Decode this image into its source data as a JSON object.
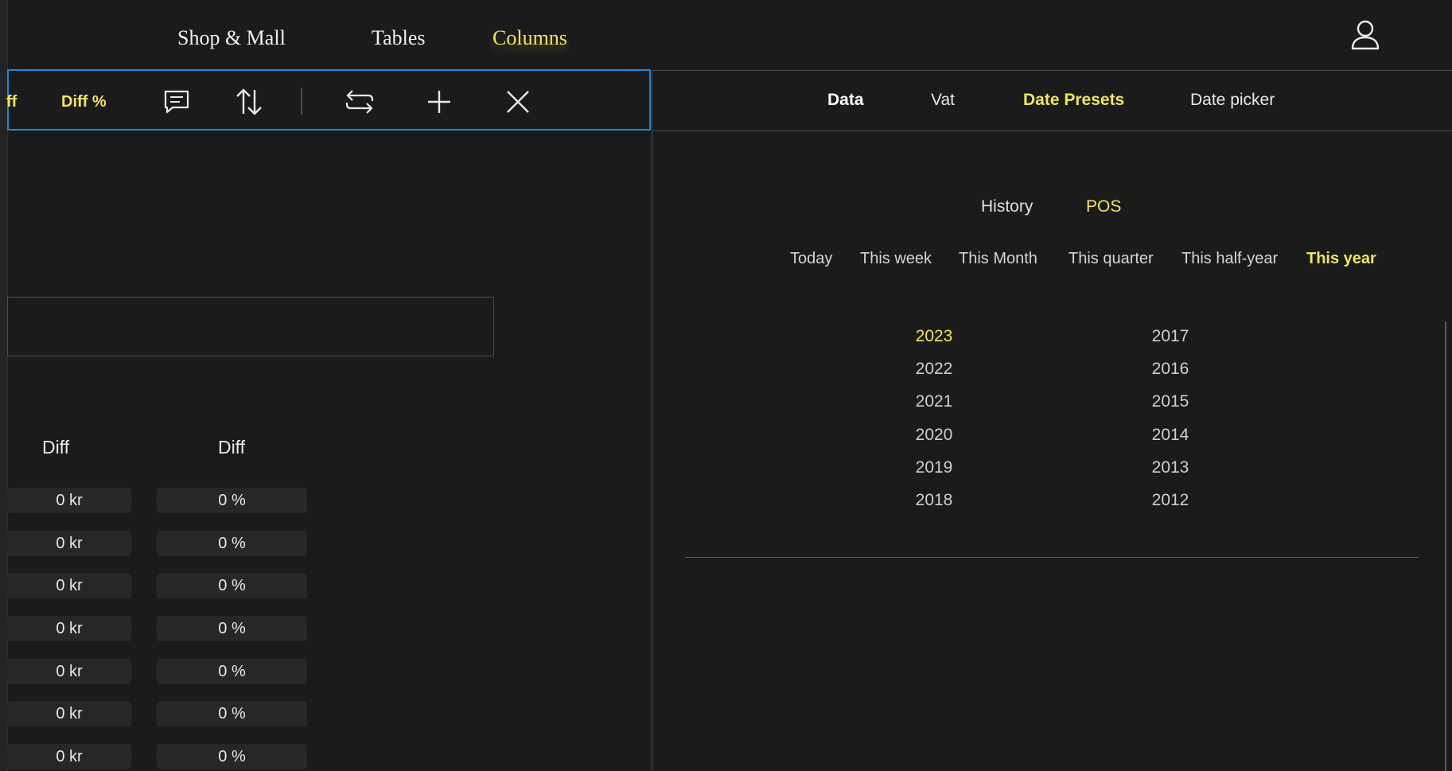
{
  "topnav": {
    "items": [
      {
        "label": "Shop & Mall"
      },
      {
        "label": "Tables"
      },
      {
        "label": "Columns"
      }
    ],
    "active": "Columns"
  },
  "toolbar": {
    "truncated_label": "ff",
    "diff_pct_label": "Diff %",
    "icons": [
      "comment-icon",
      "sort-icon",
      "swap-icon",
      "add-icon",
      "close-icon"
    ]
  },
  "table": {
    "headers": [
      "Diff",
      "Diff"
    ],
    "rows": [
      [
        "0 kr",
        "0 %"
      ],
      [
        "0 kr",
        "0 %"
      ],
      [
        "0 kr",
        "0 %"
      ],
      [
        "0 kr",
        "0 %"
      ],
      [
        "0 kr",
        "0 %"
      ],
      [
        "0 kr",
        "0 %"
      ],
      [
        "0 kr",
        "0 %"
      ]
    ]
  },
  "right_tabs": {
    "items": [
      "Data",
      "Vat",
      "Date Presets",
      "Date picker"
    ],
    "active": "Date Presets"
  },
  "subtabs": {
    "items": [
      "History",
      "POS"
    ],
    "active": "POS"
  },
  "presets": {
    "items": [
      "Today",
      "This week",
      "This Month",
      "This quarter",
      "This half-year",
      "This year"
    ],
    "active": "This year"
  },
  "years": {
    "left": [
      "2023",
      "2022",
      "2021",
      "2020",
      "2019",
      "2018"
    ],
    "right": [
      "2017",
      "2016",
      "2015",
      "2014",
      "2013",
      "2012"
    ],
    "active": "2023"
  },
  "colors": {
    "accent": "#f2e55a",
    "selection_border": "#1f86d6",
    "background": "#1b1b1c"
  }
}
